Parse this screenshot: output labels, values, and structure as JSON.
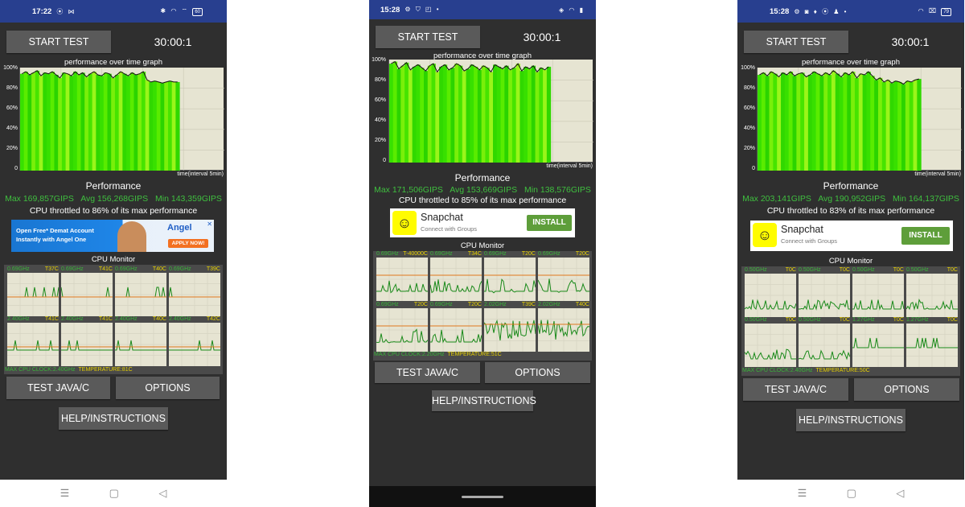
{
  "colors": {
    "status_bar": "#283f8f",
    "app_background": "#2f2f2f",
    "button": "#5a5a5a",
    "stat_green": "#3fbf3f",
    "temp_yellow": "#e8d200",
    "graph_bg": "#e6e4d2",
    "orange_line": "#e0781e",
    "freq_line": "#1a8a1a"
  },
  "phones": [
    {
      "status": {
        "time": "17:22",
        "left_icons": "⦿ ⋈",
        "right_icons": "✱ ◠ ⌔",
        "battery": "60"
      },
      "start_label": "START TEST",
      "runtime": "30:00:1",
      "graph_title": "performance over time graph",
      "y_labels": [
        "100%",
        "80%",
        "60%",
        "40%",
        "20%",
        "0"
      ],
      "x_label": "time(interval 5min)",
      "performance_label": "Performance",
      "stats": {
        "max": "Max 169,857GIPS",
        "avg": "Avg 156,268GIPS",
        "min": "Min 143,359GIPS"
      },
      "throttle": "CPU throttled to 86% of its max performance",
      "ad": {
        "type": "angel",
        "text_line1": "Open Free* Demat Account",
        "text_line2": "Instantly with Angel One",
        "logo": "Angel",
        "cta": "APPLY NOW!",
        "close": "✕"
      },
      "cpu_title": "CPU Monitor",
      "cores": [
        {
          "freq": "0.69GHz",
          "temp": "T37C"
        },
        {
          "freq": "0.69GHz",
          "temp": "T41C"
        },
        {
          "freq": "0.69GHz",
          "temp": "T40C"
        },
        {
          "freq": "0.69GHz",
          "temp": "T39C"
        },
        {
          "freq": "2.40GHz",
          "temp": "T41C"
        },
        {
          "freq": "2.40GHz",
          "temp": "T41C"
        },
        {
          "freq": "2.40GHz",
          "temp": "T40C"
        },
        {
          "freq": "2.40GHz",
          "temp": "T42C"
        }
      ],
      "max_clock": "MAX CPU CLOCK:2.40GHz",
      "temperature": "TEMPERATURE:81C",
      "java_label": "TEST JAVA/C",
      "options_label": "OPTIONS",
      "help_label": "HELP/INSTRUCTIONS",
      "nav": {
        "menu": "☰",
        "home": "▢",
        "back": "◁"
      },
      "perf_trace": {
        "samples": [
          94,
          96,
          93,
          95,
          97,
          92,
          95,
          94,
          96,
          93,
          90,
          95,
          94,
          92,
          96,
          93,
          95,
          91,
          94,
          96,
          93,
          92,
          95,
          94,
          90,
          93,
          96,
          94,
          92,
          95,
          93,
          94,
          96,
          88,
          86,
          87,
          86,
          85,
          86,
          87,
          86,
          86
        ],
        "fill_fraction": 0.78
      }
    },
    {
      "status": {
        "time": "15:28",
        "left_icons": "⚙ ⛉ ◰ •",
        "right_icons": "◈ ◠ ▮",
        "battery": ""
      },
      "start_label": "START TEST",
      "runtime": "30:00:1",
      "graph_title": "performance over time graph",
      "y_labels": [
        "100%",
        "80%",
        "60%",
        "40%",
        "20%",
        "0"
      ],
      "x_label": "time(interval 5min)",
      "performance_label": "Performance",
      "stats": {
        "max": "Max 171,506GIPS",
        "avg": "Avg 153,669GIPS",
        "min": "Min 138,576GIPS"
      },
      "throttle": "CPU throttled to 85% of its max performance",
      "ad": {
        "type": "snap",
        "name": "Snapchat",
        "sub": "Connect with Groups",
        "cta": "INSTALL",
        "logo": "☺"
      },
      "cpu_title": "CPU Monitor",
      "cores": [
        {
          "freq": "0.69GHz",
          "temp": "T-40000C"
        },
        {
          "freq": "0.69GHz",
          "temp": "T34C"
        },
        {
          "freq": "0.69GHz",
          "temp": "T20C"
        },
        {
          "freq": "0.69GHz",
          "temp": "T20C"
        },
        {
          "freq": "0.69GHz",
          "temp": "T20C"
        },
        {
          "freq": "0.69GHz",
          "temp": "T20C"
        },
        {
          "freq": "2.02GHz",
          "temp": "T39C"
        },
        {
          "freq": "2.02GHz",
          "temp": "T40C"
        }
      ],
      "max_clock": "MAX CPU CLOCK:2.20GHz",
      "temperature": "TEMPERATURE:51C",
      "java_label": "TEST JAVA/C",
      "options_label": "OPTIONS",
      "help_label": "HELP/INSTRUCTIONS",
      "nav": {
        "menu": "",
        "home": "",
        "back": ""
      },
      "perf_trace": {
        "samples": [
          96,
          98,
          91,
          94,
          97,
          90,
          93,
          95,
          92,
          89,
          94,
          96,
          88,
          93,
          95,
          90,
          92,
          96,
          94,
          89,
          91,
          95,
          93,
          90,
          94,
          92,
          88,
          95,
          93,
          91,
          94,
          90,
          92,
          96,
          89,
          93,
          91,
          94,
          88,
          92,
          90,
          93
        ],
        "fill_fraction": 0.79
      }
    },
    {
      "status": {
        "time": "15:28",
        "left_icons": "⚙ ◙ ♦ ⦿ ♟ •",
        "right_icons": "◠ ⌧",
        "battery": "79"
      },
      "start_label": "START TEST",
      "runtime": "30:00:1",
      "graph_title": "performance over time graph",
      "y_labels": [
        "100%",
        "80%",
        "60%",
        "40%",
        "20%",
        "0"
      ],
      "x_label": "time(interval 5min)",
      "performance_label": "Performance",
      "stats": {
        "max": "Max 203,141GIPS",
        "avg": "Avg 190,952GIPS",
        "min": "Min 164,137GIPS"
      },
      "throttle": "CPU throttled to 83% of its max performance",
      "ad": {
        "type": "snap",
        "name": "Snapchat",
        "sub": "Connect with Groups",
        "cta": "INSTALL",
        "logo": "☺"
      },
      "cpu_title": "CPU Monitor",
      "cores": [
        {
          "freq": "0.50GHz",
          "temp": "T0C"
        },
        {
          "freq": "0.50GHz",
          "temp": "T0C"
        },
        {
          "freq": "0.50GHz",
          "temp": "T0C"
        },
        {
          "freq": "0.50GHz",
          "temp": "T0C"
        },
        {
          "freq": "0.50GHz",
          "temp": "T0C"
        },
        {
          "freq": "0.50GHz",
          "temp": "T0C"
        },
        {
          "freq": "1.27GHz",
          "temp": "T0C"
        },
        {
          "freq": "1.27GHz",
          "temp": "T0C"
        }
      ],
      "max_clock": "MAX CPU CLOCK:2.40GHz",
      "temperature": "TEMPERATURE:50C",
      "java_label": "TEST JAVA/C",
      "options_label": "OPTIONS",
      "help_label": "HELP/INSTRUCTIONS",
      "nav": {
        "menu": "☰",
        "home": "▢",
        "back": "◁"
      },
      "perf_trace": {
        "samples": [
          93,
          95,
          92,
          96,
          94,
          91,
          95,
          93,
          96,
          92,
          94,
          95,
          91,
          93,
          96,
          94,
          92,
          95,
          93,
          97,
          94,
          91,
          95,
          93,
          96,
          90,
          94,
          93,
          96,
          92,
          88,
          90,
          86,
          88,
          85,
          87,
          86,
          84,
          87,
          86,
          88,
          89
        ],
        "fill_fraction": 0.8
      }
    }
  ]
}
